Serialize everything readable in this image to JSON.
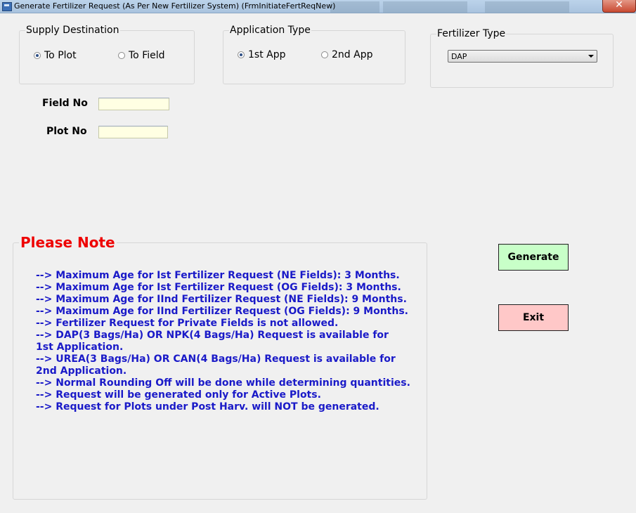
{
  "window": {
    "title": "Generate Fertilizer Request (As Per New Fertilizer System) (FrmInitiateFertReqNew)",
    "close_symbol": "✕"
  },
  "supply_destination": {
    "legend": "Supply Destination",
    "options": [
      {
        "label": "To Plot",
        "checked": true
      },
      {
        "label": "To Field",
        "checked": false
      }
    ]
  },
  "application_type": {
    "legend": "Application Type",
    "options": [
      {
        "label": "1st App",
        "checked": true
      },
      {
        "label": "2nd App",
        "checked": false
      }
    ]
  },
  "fertilizer_type": {
    "legend": "Fertilizer Type",
    "selected": "DAP"
  },
  "fields": {
    "field_no_label": "Field No",
    "field_no_value": "",
    "plot_no_label": "Plot No",
    "plot_no_value": ""
  },
  "note": {
    "heading": "Please Note",
    "lines": [
      "--> Maximum Age for Ist Fertilizer Request (NE Fields): 3 Months.",
      "--> Maximum Age for Ist Fertilizer Request (OG Fields): 3 Months.",
      "--> Maximum Age for IInd Fertilizer Request (NE Fields): 9 Months.",
      "--> Maximum Age for IInd Fertilizer Request (OG Fields): 9 Months.",
      "--> Fertilizer Request for Private Fields is not allowed.",
      "--> DAP(3 Bags/Ha) OR NPK(4 Bags/Ha) Request is available for",
      "1st Application.",
      "--> UREA(3 Bags/Ha) OR CAN(4 Bags/Ha) Request is available for",
      "2nd Application.",
      "--> Normal Rounding Off will be done while determining quantities.",
      "--> Request will be generated only for Active Plots.",
      "--> Request for Plots under Post Harv. will NOT be generated."
    ]
  },
  "buttons": {
    "generate_label": "Generate",
    "exit_label": "Exit"
  },
  "colors": {
    "generate_bg": "#c8ffc8",
    "exit_bg": "#ffc8c8",
    "note_heading": "#ee0000",
    "note_text": "#1a1ac8"
  }
}
